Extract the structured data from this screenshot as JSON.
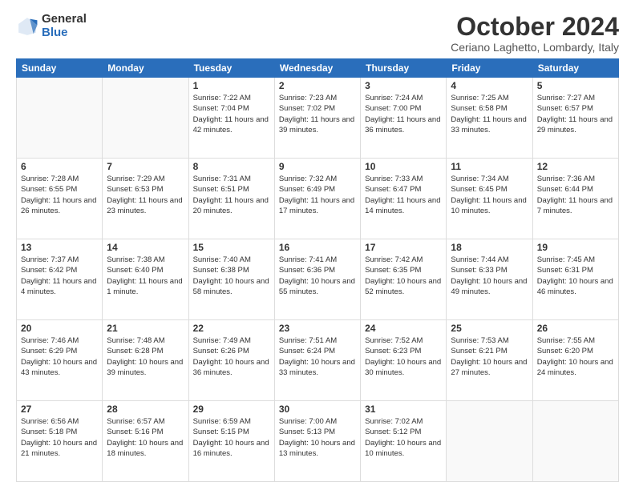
{
  "logo": {
    "general": "General",
    "blue": "Blue"
  },
  "header": {
    "month": "October 2024",
    "location": "Ceriano Laghetto, Lombardy, Italy"
  },
  "weekdays": [
    "Sunday",
    "Monday",
    "Tuesday",
    "Wednesday",
    "Thursday",
    "Friday",
    "Saturday"
  ],
  "weeks": [
    [
      {
        "day": "",
        "info": ""
      },
      {
        "day": "",
        "info": ""
      },
      {
        "day": "1",
        "info": "Sunrise: 7:22 AM\nSunset: 7:04 PM\nDaylight: 11 hours and 42 minutes."
      },
      {
        "day": "2",
        "info": "Sunrise: 7:23 AM\nSunset: 7:02 PM\nDaylight: 11 hours and 39 minutes."
      },
      {
        "day": "3",
        "info": "Sunrise: 7:24 AM\nSunset: 7:00 PM\nDaylight: 11 hours and 36 minutes."
      },
      {
        "day": "4",
        "info": "Sunrise: 7:25 AM\nSunset: 6:58 PM\nDaylight: 11 hours and 33 minutes."
      },
      {
        "day": "5",
        "info": "Sunrise: 7:27 AM\nSunset: 6:57 PM\nDaylight: 11 hours and 29 minutes."
      }
    ],
    [
      {
        "day": "6",
        "info": "Sunrise: 7:28 AM\nSunset: 6:55 PM\nDaylight: 11 hours and 26 minutes."
      },
      {
        "day": "7",
        "info": "Sunrise: 7:29 AM\nSunset: 6:53 PM\nDaylight: 11 hours and 23 minutes."
      },
      {
        "day": "8",
        "info": "Sunrise: 7:31 AM\nSunset: 6:51 PM\nDaylight: 11 hours and 20 minutes."
      },
      {
        "day": "9",
        "info": "Sunrise: 7:32 AM\nSunset: 6:49 PM\nDaylight: 11 hours and 17 minutes."
      },
      {
        "day": "10",
        "info": "Sunrise: 7:33 AM\nSunset: 6:47 PM\nDaylight: 11 hours and 14 minutes."
      },
      {
        "day": "11",
        "info": "Sunrise: 7:34 AM\nSunset: 6:45 PM\nDaylight: 11 hours and 10 minutes."
      },
      {
        "day": "12",
        "info": "Sunrise: 7:36 AM\nSunset: 6:44 PM\nDaylight: 11 hours and 7 minutes."
      }
    ],
    [
      {
        "day": "13",
        "info": "Sunrise: 7:37 AM\nSunset: 6:42 PM\nDaylight: 11 hours and 4 minutes."
      },
      {
        "day": "14",
        "info": "Sunrise: 7:38 AM\nSunset: 6:40 PM\nDaylight: 11 hours and 1 minute."
      },
      {
        "day": "15",
        "info": "Sunrise: 7:40 AM\nSunset: 6:38 PM\nDaylight: 10 hours and 58 minutes."
      },
      {
        "day": "16",
        "info": "Sunrise: 7:41 AM\nSunset: 6:36 PM\nDaylight: 10 hours and 55 minutes."
      },
      {
        "day": "17",
        "info": "Sunrise: 7:42 AM\nSunset: 6:35 PM\nDaylight: 10 hours and 52 minutes."
      },
      {
        "day": "18",
        "info": "Sunrise: 7:44 AM\nSunset: 6:33 PM\nDaylight: 10 hours and 49 minutes."
      },
      {
        "day": "19",
        "info": "Sunrise: 7:45 AM\nSunset: 6:31 PM\nDaylight: 10 hours and 46 minutes."
      }
    ],
    [
      {
        "day": "20",
        "info": "Sunrise: 7:46 AM\nSunset: 6:29 PM\nDaylight: 10 hours and 43 minutes."
      },
      {
        "day": "21",
        "info": "Sunrise: 7:48 AM\nSunset: 6:28 PM\nDaylight: 10 hours and 39 minutes."
      },
      {
        "day": "22",
        "info": "Sunrise: 7:49 AM\nSunset: 6:26 PM\nDaylight: 10 hours and 36 minutes."
      },
      {
        "day": "23",
        "info": "Sunrise: 7:51 AM\nSunset: 6:24 PM\nDaylight: 10 hours and 33 minutes."
      },
      {
        "day": "24",
        "info": "Sunrise: 7:52 AM\nSunset: 6:23 PM\nDaylight: 10 hours and 30 minutes."
      },
      {
        "day": "25",
        "info": "Sunrise: 7:53 AM\nSunset: 6:21 PM\nDaylight: 10 hours and 27 minutes."
      },
      {
        "day": "26",
        "info": "Sunrise: 7:55 AM\nSunset: 6:20 PM\nDaylight: 10 hours and 24 minutes."
      }
    ],
    [
      {
        "day": "27",
        "info": "Sunrise: 6:56 AM\nSunset: 5:18 PM\nDaylight: 10 hours and 21 minutes."
      },
      {
        "day": "28",
        "info": "Sunrise: 6:57 AM\nSunset: 5:16 PM\nDaylight: 10 hours and 18 minutes."
      },
      {
        "day": "29",
        "info": "Sunrise: 6:59 AM\nSunset: 5:15 PM\nDaylight: 10 hours and 16 minutes."
      },
      {
        "day": "30",
        "info": "Sunrise: 7:00 AM\nSunset: 5:13 PM\nDaylight: 10 hours and 13 minutes."
      },
      {
        "day": "31",
        "info": "Sunrise: 7:02 AM\nSunset: 5:12 PM\nDaylight: 10 hours and 10 minutes."
      },
      {
        "day": "",
        "info": ""
      },
      {
        "day": "",
        "info": ""
      }
    ]
  ]
}
